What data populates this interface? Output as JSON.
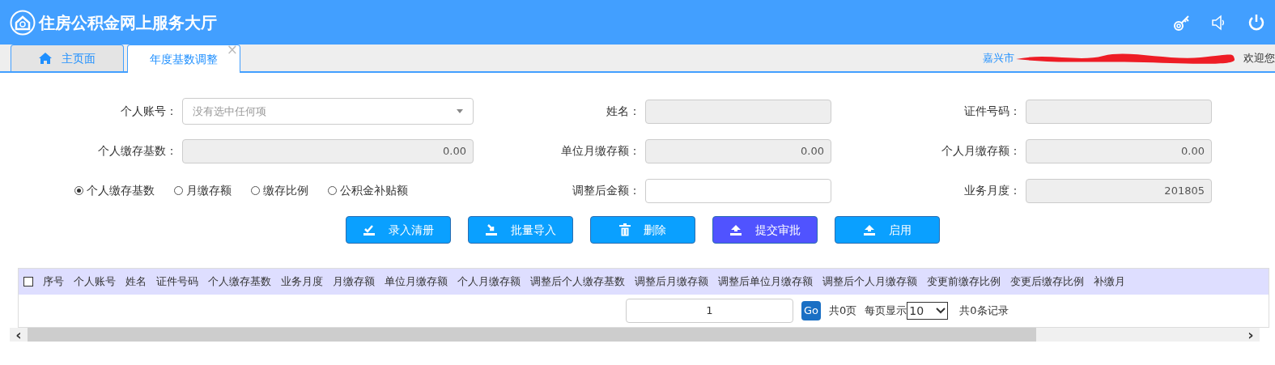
{
  "header": {
    "title": "住房公积金网上服务大厅"
  },
  "tabs": [
    {
      "label": "主页面",
      "selected": false,
      "kind": "home",
      "closable": false
    },
    {
      "label": "年度基数调整",
      "selected": true,
      "kind": "plain",
      "closable": true
    }
  ],
  "tab_close": "×",
  "user_bar": {
    "city": "嘉兴市",
    "welcome": "欢迎您"
  },
  "form_rows": [
    [
      {
        "label": "个人账号：",
        "kind": "select",
        "placeholder": "没有选中任何项"
      },
      {
        "label": "姓名：",
        "kind": "readonly"
      },
      {
        "label": "证件号码：",
        "kind": "readonly"
      }
    ],
    [
      {
        "label": "个人缴存基数：",
        "kind": "readonly",
        "value": "0.00"
      },
      {
        "label": "单位月缴存额：",
        "kind": "readonly",
        "value": "0.00"
      },
      {
        "label": "个人月缴存额：",
        "kind": "readonly",
        "value": "0.00"
      }
    ],
    [
      {
        "kind": "radios"
      },
      {
        "label": "调整后金额：",
        "kind": "input"
      },
      {
        "label": "业务月度：",
        "kind": "readonly",
        "value": "201805"
      }
    ]
  ],
  "radios": [
    {
      "label": "个人缴存基数",
      "selected": true
    },
    {
      "label": "月缴存额",
      "selected": false
    },
    {
      "label": "缴存比例",
      "selected": false
    },
    {
      "label": "公积金补贴额",
      "selected": false
    }
  ],
  "buttons": [
    {
      "label": "录入清册",
      "kind": "check",
      "color": "#0aa0ff"
    },
    {
      "label": "批量导入",
      "kind": "import",
      "color": "#0aa0ff"
    },
    {
      "label": "删除",
      "kind": "trash",
      "color": "#0aa0ff"
    },
    {
      "label": "提交审批",
      "kind": "upload",
      "color": "#5053ff"
    },
    {
      "label": "启用",
      "kind": "upload",
      "color": "#0aa0ff"
    }
  ],
  "table": {
    "select_all_checked": false,
    "columns": [
      "序号",
      "个人账号",
      "姓名",
      "证件号码",
      "个人缴存基数",
      "业务月度",
      "月缴存额",
      "单位月缴存额",
      "个人月缴存额",
      "调整后个人缴存基数",
      "调整后月缴存额",
      "调整后单位月缴存额",
      "调整后个人月缴存额",
      "变更前缴存比例",
      "变更后缴存比例",
      "补缴月"
    ]
  },
  "pager": {
    "page": "1",
    "go": "Go",
    "total_pages": "共0页",
    "per_page_label": "每页显示",
    "per_page": "10",
    "total_records": "共0条记录"
  },
  "scrollbar": {
    "left": "‹",
    "right": "›"
  }
}
